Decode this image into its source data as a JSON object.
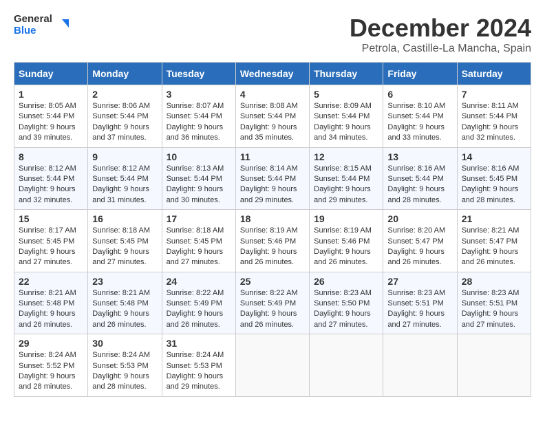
{
  "logo": {
    "line1": "General",
    "line2": "Blue"
  },
  "title": "December 2024",
  "subtitle": "Petrola, Castille-La Mancha, Spain",
  "weekdays": [
    "Sunday",
    "Monday",
    "Tuesday",
    "Wednesday",
    "Thursday",
    "Friday",
    "Saturday"
  ],
  "weeks": [
    [
      {
        "day": "1",
        "sunrise": "Sunrise: 8:05 AM",
        "sunset": "Sunset: 5:44 PM",
        "daylight": "Daylight: 9 hours and 39 minutes."
      },
      {
        "day": "2",
        "sunrise": "Sunrise: 8:06 AM",
        "sunset": "Sunset: 5:44 PM",
        "daylight": "Daylight: 9 hours and 37 minutes."
      },
      {
        "day": "3",
        "sunrise": "Sunrise: 8:07 AM",
        "sunset": "Sunset: 5:44 PM",
        "daylight": "Daylight: 9 hours and 36 minutes."
      },
      {
        "day": "4",
        "sunrise": "Sunrise: 8:08 AM",
        "sunset": "Sunset: 5:44 PM",
        "daylight": "Daylight: 9 hours and 35 minutes."
      },
      {
        "day": "5",
        "sunrise": "Sunrise: 8:09 AM",
        "sunset": "Sunset: 5:44 PM",
        "daylight": "Daylight: 9 hours and 34 minutes."
      },
      {
        "day": "6",
        "sunrise": "Sunrise: 8:10 AM",
        "sunset": "Sunset: 5:44 PM",
        "daylight": "Daylight: 9 hours and 33 minutes."
      },
      {
        "day": "7",
        "sunrise": "Sunrise: 8:11 AM",
        "sunset": "Sunset: 5:44 PM",
        "daylight": "Daylight: 9 hours and 32 minutes."
      }
    ],
    [
      {
        "day": "8",
        "sunrise": "Sunrise: 8:12 AM",
        "sunset": "Sunset: 5:44 PM",
        "daylight": "Daylight: 9 hours and 32 minutes."
      },
      {
        "day": "9",
        "sunrise": "Sunrise: 8:12 AM",
        "sunset": "Sunset: 5:44 PM",
        "daylight": "Daylight: 9 hours and 31 minutes."
      },
      {
        "day": "10",
        "sunrise": "Sunrise: 8:13 AM",
        "sunset": "Sunset: 5:44 PM",
        "daylight": "Daylight: 9 hours and 30 minutes."
      },
      {
        "day": "11",
        "sunrise": "Sunrise: 8:14 AM",
        "sunset": "Sunset: 5:44 PM",
        "daylight": "Daylight: 9 hours and 29 minutes."
      },
      {
        "day": "12",
        "sunrise": "Sunrise: 8:15 AM",
        "sunset": "Sunset: 5:44 PM",
        "daylight": "Daylight: 9 hours and 29 minutes."
      },
      {
        "day": "13",
        "sunrise": "Sunrise: 8:16 AM",
        "sunset": "Sunset: 5:44 PM",
        "daylight": "Daylight: 9 hours and 28 minutes."
      },
      {
        "day": "14",
        "sunrise": "Sunrise: 8:16 AM",
        "sunset": "Sunset: 5:45 PM",
        "daylight": "Daylight: 9 hours and 28 minutes."
      }
    ],
    [
      {
        "day": "15",
        "sunrise": "Sunrise: 8:17 AM",
        "sunset": "Sunset: 5:45 PM",
        "daylight": "Daylight: 9 hours and 27 minutes."
      },
      {
        "day": "16",
        "sunrise": "Sunrise: 8:18 AM",
        "sunset": "Sunset: 5:45 PM",
        "daylight": "Daylight: 9 hours and 27 minutes."
      },
      {
        "day": "17",
        "sunrise": "Sunrise: 8:18 AM",
        "sunset": "Sunset: 5:45 PM",
        "daylight": "Daylight: 9 hours and 27 minutes."
      },
      {
        "day": "18",
        "sunrise": "Sunrise: 8:19 AM",
        "sunset": "Sunset: 5:46 PM",
        "daylight": "Daylight: 9 hours and 26 minutes."
      },
      {
        "day": "19",
        "sunrise": "Sunrise: 8:19 AM",
        "sunset": "Sunset: 5:46 PM",
        "daylight": "Daylight: 9 hours and 26 minutes."
      },
      {
        "day": "20",
        "sunrise": "Sunrise: 8:20 AM",
        "sunset": "Sunset: 5:47 PM",
        "daylight": "Daylight: 9 hours and 26 minutes."
      },
      {
        "day": "21",
        "sunrise": "Sunrise: 8:21 AM",
        "sunset": "Sunset: 5:47 PM",
        "daylight": "Daylight: 9 hours and 26 minutes."
      }
    ],
    [
      {
        "day": "22",
        "sunrise": "Sunrise: 8:21 AM",
        "sunset": "Sunset: 5:48 PM",
        "daylight": "Daylight: 9 hours and 26 minutes."
      },
      {
        "day": "23",
        "sunrise": "Sunrise: 8:21 AM",
        "sunset": "Sunset: 5:48 PM",
        "daylight": "Daylight: 9 hours and 26 minutes."
      },
      {
        "day": "24",
        "sunrise": "Sunrise: 8:22 AM",
        "sunset": "Sunset: 5:49 PM",
        "daylight": "Daylight: 9 hours and 26 minutes."
      },
      {
        "day": "25",
        "sunrise": "Sunrise: 8:22 AM",
        "sunset": "Sunset: 5:49 PM",
        "daylight": "Daylight: 9 hours and 26 minutes."
      },
      {
        "day": "26",
        "sunrise": "Sunrise: 8:23 AM",
        "sunset": "Sunset: 5:50 PM",
        "daylight": "Daylight: 9 hours and 27 minutes."
      },
      {
        "day": "27",
        "sunrise": "Sunrise: 8:23 AM",
        "sunset": "Sunset: 5:51 PM",
        "daylight": "Daylight: 9 hours and 27 minutes."
      },
      {
        "day": "28",
        "sunrise": "Sunrise: 8:23 AM",
        "sunset": "Sunset: 5:51 PM",
        "daylight": "Daylight: 9 hours and 27 minutes."
      }
    ],
    [
      {
        "day": "29",
        "sunrise": "Sunrise: 8:24 AM",
        "sunset": "Sunset: 5:52 PM",
        "daylight": "Daylight: 9 hours and 28 minutes."
      },
      {
        "day": "30",
        "sunrise": "Sunrise: 8:24 AM",
        "sunset": "Sunset: 5:53 PM",
        "daylight": "Daylight: 9 hours and 28 minutes."
      },
      {
        "day": "31",
        "sunrise": "Sunrise: 8:24 AM",
        "sunset": "Sunset: 5:53 PM",
        "daylight": "Daylight: 9 hours and 29 minutes."
      },
      null,
      null,
      null,
      null
    ]
  ]
}
